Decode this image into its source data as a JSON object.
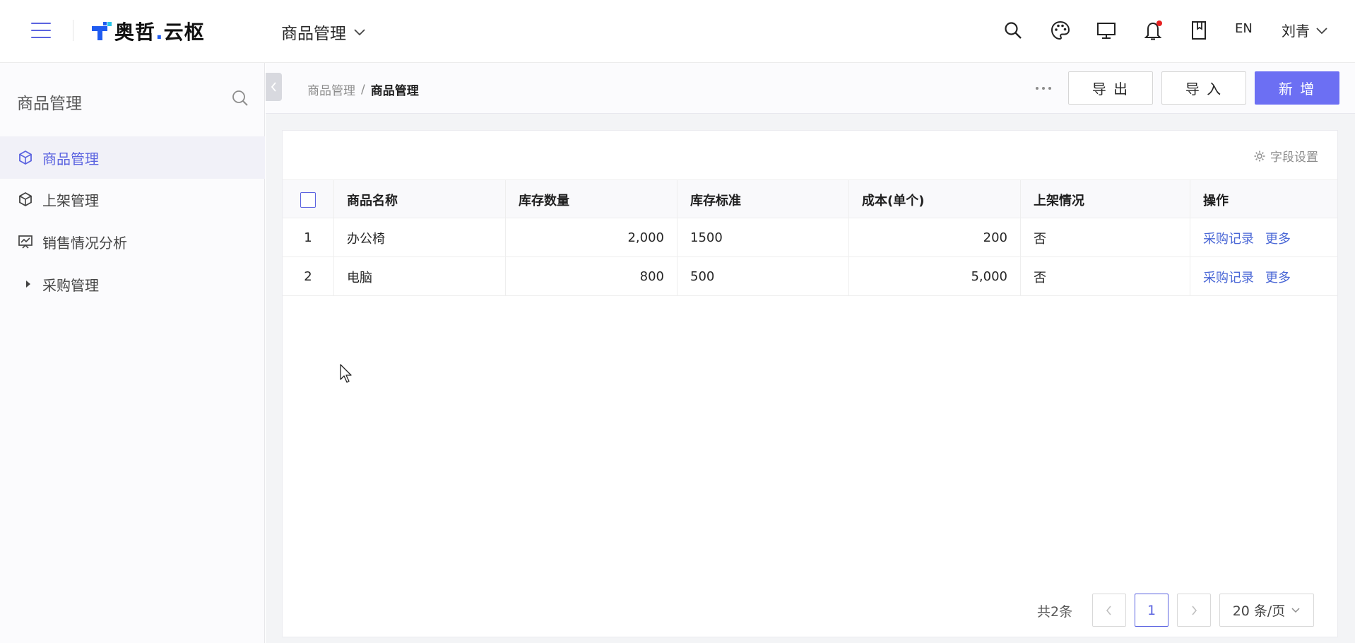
{
  "header": {
    "logo_text_a": "奥哲",
    "logo_dot": ".",
    "logo_text_b": "云枢",
    "module_label": "商品管理",
    "lang_label": "EN",
    "user_name": "刘青"
  },
  "sidebar": {
    "title": "商品管理",
    "items": [
      {
        "label": "商品管理",
        "icon": "cube-icon",
        "active": true
      },
      {
        "label": "上架管理",
        "icon": "cube-icon",
        "active": false
      },
      {
        "label": "销售情况分析",
        "icon": "chart-board-icon",
        "active": false
      },
      {
        "label": "采购管理",
        "icon": "caret-right-icon",
        "active": false
      }
    ]
  },
  "breadcrumb": {
    "parent": "商品管理",
    "separator": "/",
    "current": "商品管理"
  },
  "toolbar": {
    "export_label": "导 出",
    "import_label": "导 入",
    "add_label": "新 增",
    "field_settings_label": "字段设置"
  },
  "table": {
    "columns": [
      "商品名称",
      "库存数量",
      "库存标准",
      "成本(单个)",
      "上架情况",
      "操作"
    ],
    "rows": [
      {
        "index": "1",
        "name": "办公椅",
        "stock": "2,000",
        "standard": "1500",
        "cost": "200",
        "listed": "否",
        "action_record": "采购记录",
        "action_more": "更多"
      },
      {
        "index": "2",
        "name": "电脑",
        "stock": "800",
        "standard": "500",
        "cost": "5,000",
        "listed": "否",
        "action_record": "采购记录",
        "action_more": "更多"
      }
    ]
  },
  "pagination": {
    "total_label": "共2条",
    "current_page": "1",
    "page_size_label": "20 条/页"
  },
  "colors": {
    "accent": "#5b63e0",
    "primary_button": "#6c6ff3",
    "link": "#4a67d6",
    "notification_dot": "#e62020"
  }
}
